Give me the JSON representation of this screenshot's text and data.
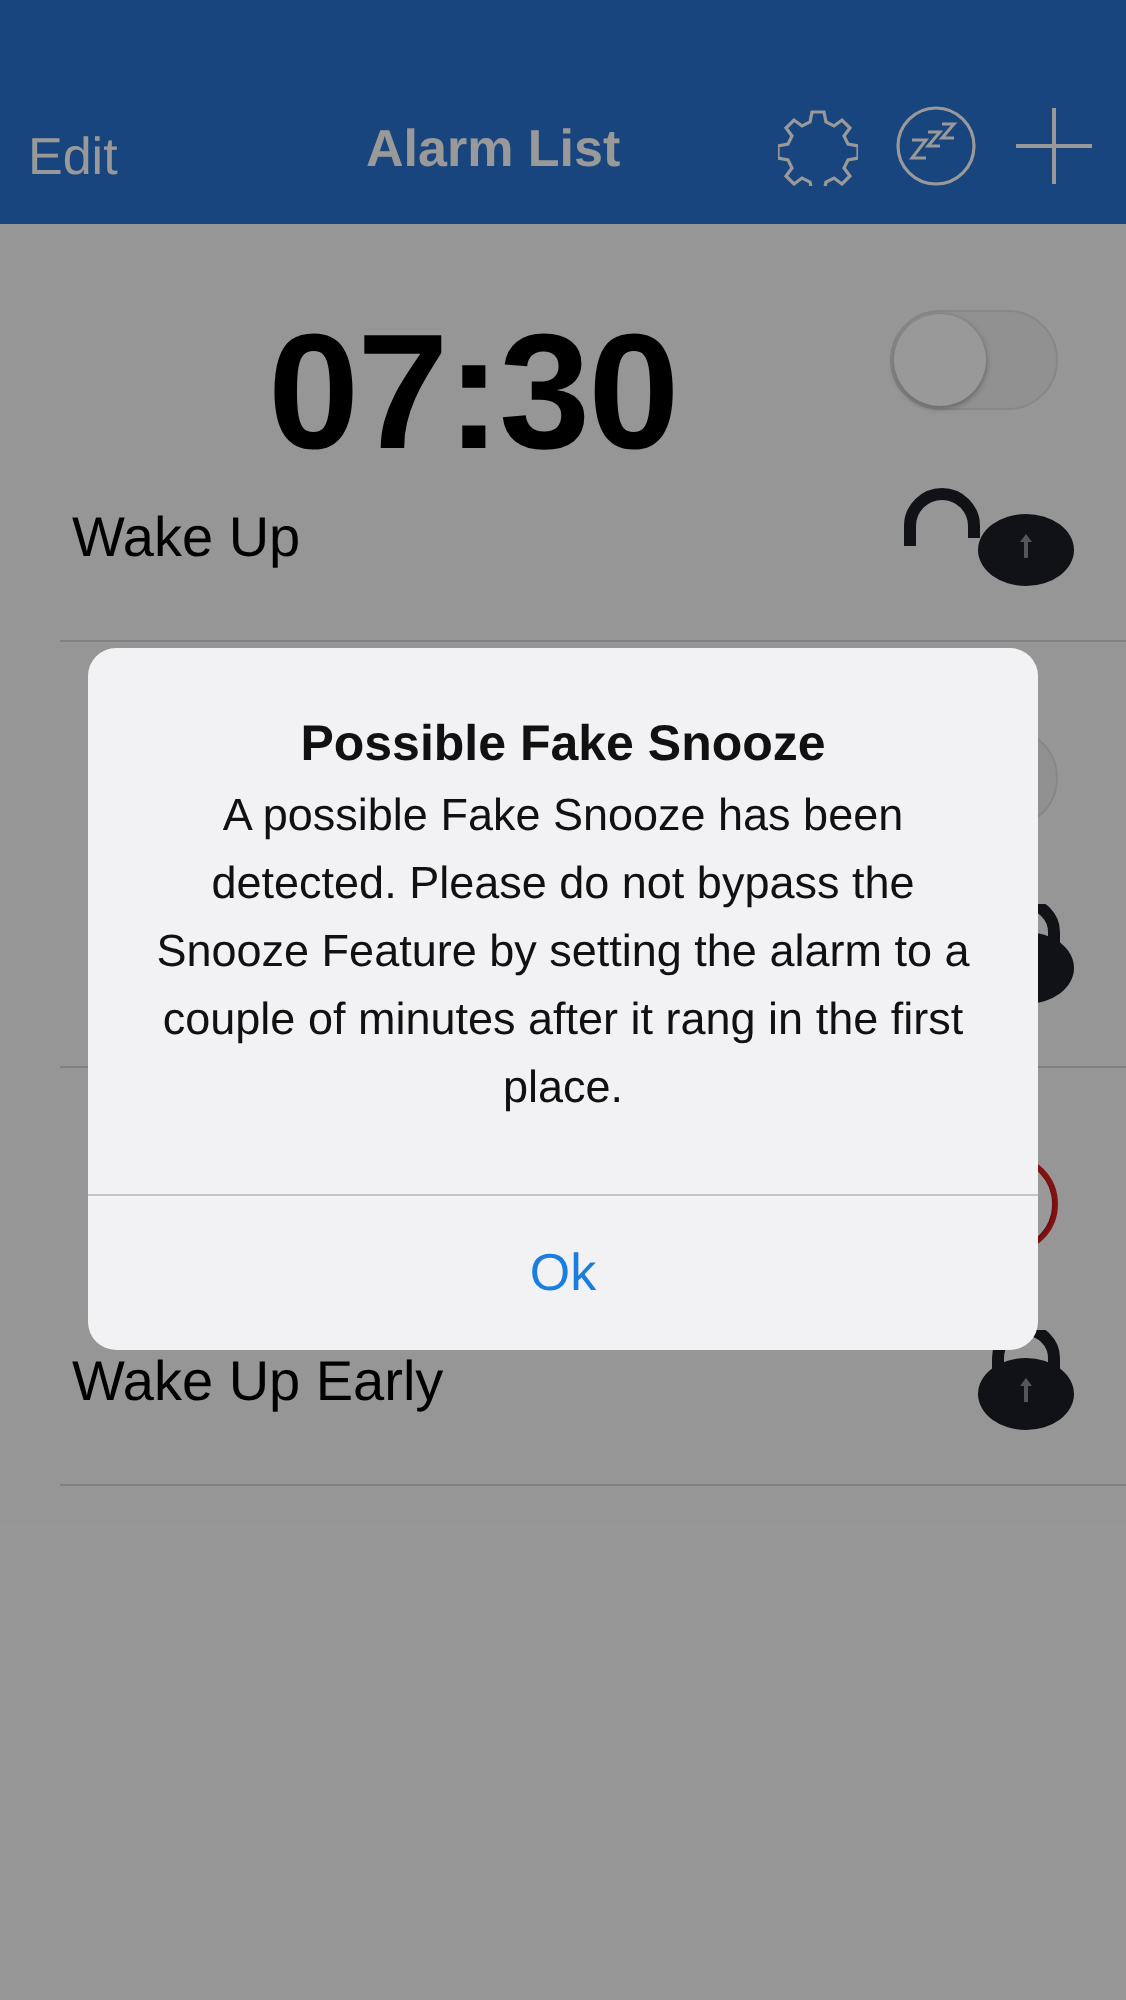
{
  "nav": {
    "edit": "Edit",
    "title": "Alarm List"
  },
  "alarms": [
    {
      "time": "07:30",
      "label": "Wake Up",
      "on": false,
      "locked": false
    },
    {
      "on": false,
      "locked": true
    },
    {
      "label": "Wake Up Early",
      "on": true,
      "locked": true
    }
  ],
  "dialog": {
    "title": "Possible Fake Snooze",
    "message": "A possible Fake Snooze has been detected. Please do not bypass the Snooze Feature by setting the alarm to a couple of minutes after it rang in the first place.",
    "button": "Ok"
  }
}
